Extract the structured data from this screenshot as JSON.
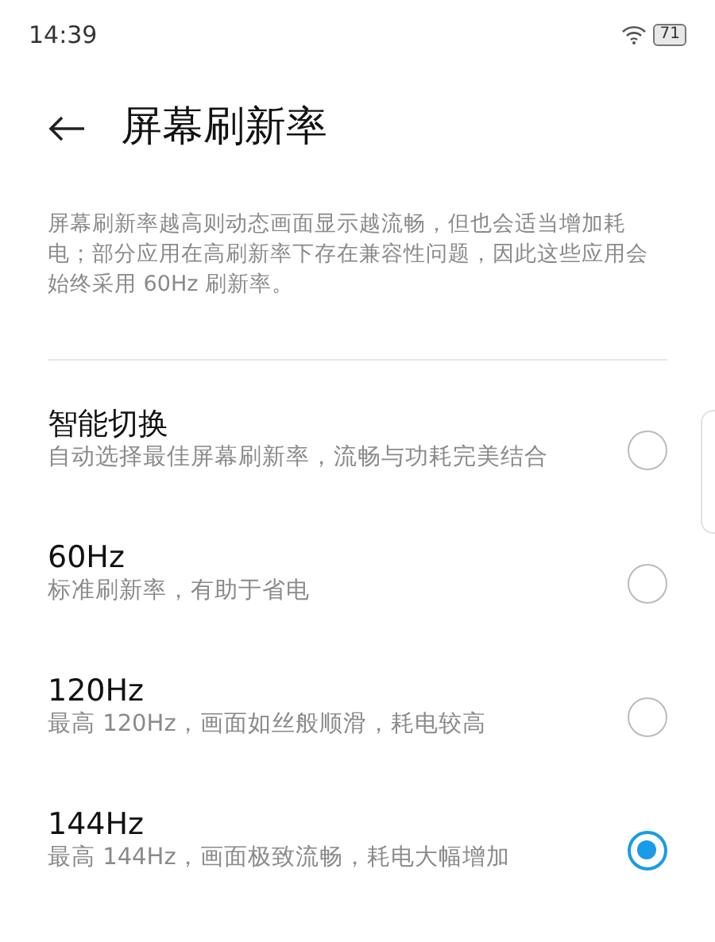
{
  "status_bar": {
    "time": "14:39",
    "battery": "71"
  },
  "header": {
    "title": "屏幕刷新率"
  },
  "description": "屏幕刷新率越高则动态画面显示越流畅，但也会适当增加耗电；部分应用在高刷新率下存在兼容性问题，因此这些应用会始终采用 60Hz 刷新率。",
  "options": [
    {
      "title": "智能切换",
      "subtitle": "自动选择最佳屏幕刷新率，流畅与功耗完美结合",
      "selected": false
    },
    {
      "title": "60Hz",
      "subtitle": "标准刷新率，有助于省电",
      "selected": false
    },
    {
      "title": "120Hz",
      "subtitle": "最高 120Hz，画面如丝般顺滑，耗电较高",
      "selected": false
    },
    {
      "title": "144Hz",
      "subtitle": "最高 144Hz，画面极致流畅，耗电大幅增加",
      "selected": true
    }
  ]
}
